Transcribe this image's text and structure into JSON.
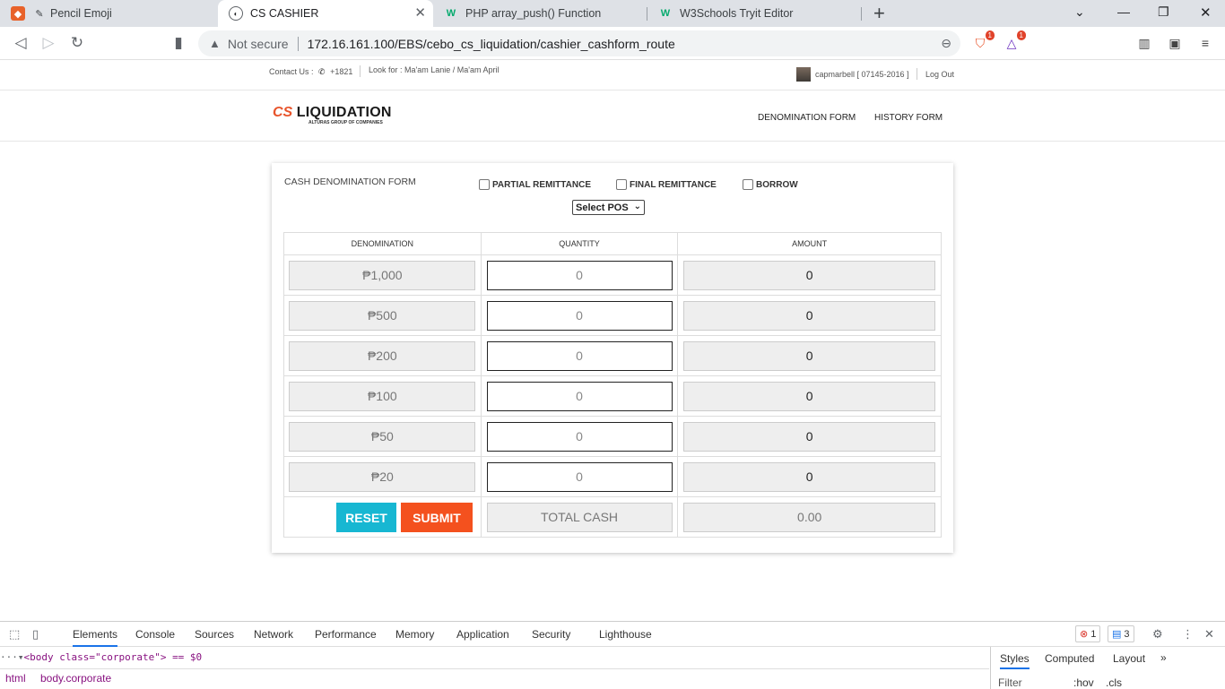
{
  "browser": {
    "tabs": [
      {
        "title": "Pencil Emoji"
      },
      {
        "title": "CS CASHIER"
      },
      {
        "title": "PHP array_push() Function"
      },
      {
        "title": "W3Schools Tryit Editor"
      }
    ],
    "security_label": "Not secure",
    "url": "172.16.161.100/EBS/cebo_cs_liquidation/cashier_cashform_route",
    "brave_badge": "1",
    "rewards_badge": "1"
  },
  "topbar": {
    "contact": "Contact Us :",
    "phone": "+1821",
    "look_for": "Look for : Ma'am Lanie / Ma'am April",
    "user": "capmarbell [ 07145-2016 ]",
    "logout": "Log Out"
  },
  "header": {
    "logo_mark": "CS",
    "logo_word": "LIQUIDATION",
    "logo_sub": "ALTURAS GROUP OF COMPANIES",
    "nav": [
      "DENOMINATION FORM",
      "HISTORY FORM"
    ]
  },
  "form": {
    "title": "CASH DENOMINATION FORM",
    "options": [
      "PARTIAL REMITTANCE",
      "FINAL REMITTANCE",
      "BORROW"
    ],
    "pos_select": "Select POS",
    "headers": [
      "DENOMINATION",
      "QUANTITY",
      "AMOUNT"
    ],
    "rows": [
      {
        "denomination": "₱1,000",
        "quantity": "0",
        "amount": "0"
      },
      {
        "denomination": "₱500",
        "quantity": "0",
        "amount": "0"
      },
      {
        "denomination": "₱200",
        "quantity": "0",
        "amount": "0"
      },
      {
        "denomination": "₱100",
        "quantity": "0",
        "amount": "0"
      },
      {
        "denomination": "₱50",
        "quantity": "0",
        "amount": "0"
      },
      {
        "denomination": "₱20",
        "quantity": "0",
        "amount": "0"
      }
    ],
    "reset_label": "RESET",
    "submit_label": "SUBMIT",
    "total_label": "TOTAL CASH",
    "total_value": "0.00"
  },
  "devtools": {
    "tabs": [
      "Elements",
      "Console",
      "Sources",
      "Network",
      "Performance",
      "Memory",
      "Application",
      "Security",
      "Lighthouse"
    ],
    "errors": "1",
    "messages": "3",
    "dom_line": "<body class=\"corporate\"> == $0",
    "crumbs": [
      "html",
      "body.corporate"
    ],
    "side_tabs": [
      "Styles",
      "Computed",
      "Layout"
    ],
    "filter": "Filter",
    "hov": ":hov",
    "cls": ".cls"
  }
}
